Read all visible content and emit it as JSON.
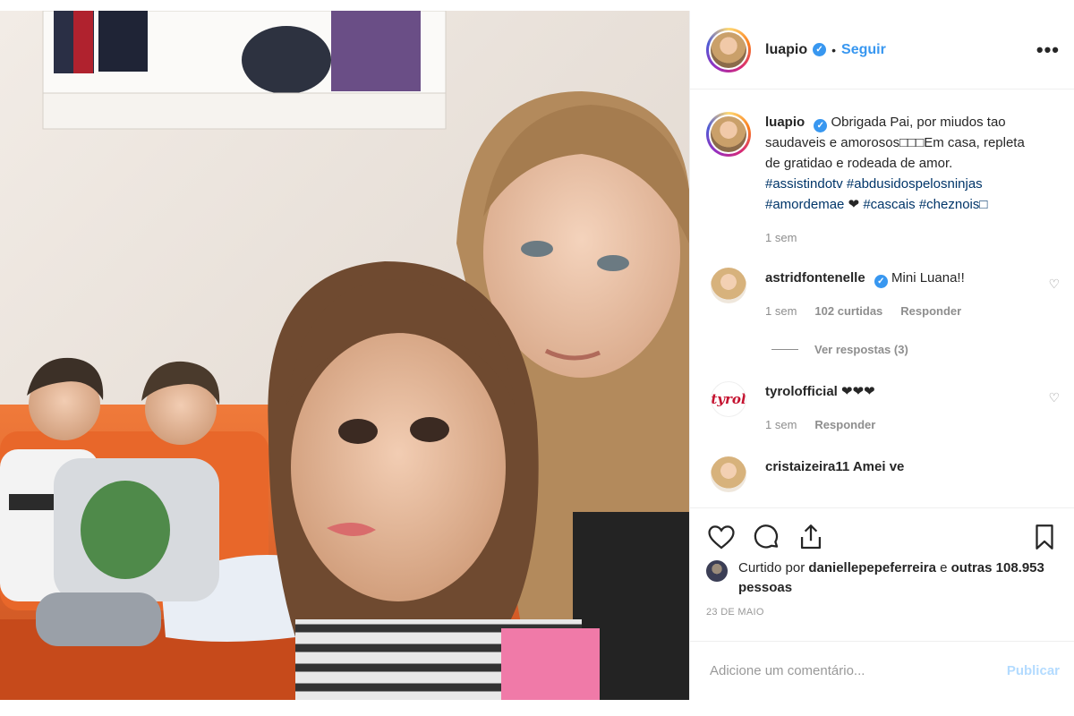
{
  "post": {
    "username": "luapio",
    "separator": "•",
    "follow_label": "Seguir",
    "more_label": "•••"
  },
  "caption": {
    "username": "luapio",
    "text_before": "Obrigada Pai, por miudos tao saudaveis e amorosos□□□Em casa, repleta de gratidao e rodeada de amor. ",
    "tag1": "#assistindotv",
    "tag2": "#abdusidospelosninjas",
    "tag3": "#amordemae",
    "heart": "❤",
    "tag4": "#cascais",
    "tag5": "#cheznois□",
    "time": "1 sem"
  },
  "comments": [
    {
      "username": "astridfontenelle",
      "text": "Mini Luana!!",
      "time": "1 sem",
      "likes": "102 curtidas",
      "reply_label": "Responder",
      "view_replies": "Ver respostas (3)"
    },
    {
      "username": "tyrolofficial",
      "avatar_text": "tyrol",
      "text": "❤❤❤",
      "time": "1 sem",
      "reply_label": "Responder"
    }
  ],
  "partial_comment": "cristaizeira11 Amei ve",
  "likes": {
    "prefix": "Curtido por ",
    "user": "daniellepepeferreira",
    "middle": " e ",
    "others": "outras 108.953 pessoas"
  },
  "date": "23 DE MAIO",
  "add_comment": {
    "placeholder": "Adicione um comentário...",
    "publish_label": "Publicar"
  },
  "colors": {
    "link": "#3897f0",
    "hashtag": "#003569",
    "muted": "#8e8e8e",
    "publish_disabled": "#b3dbff"
  }
}
